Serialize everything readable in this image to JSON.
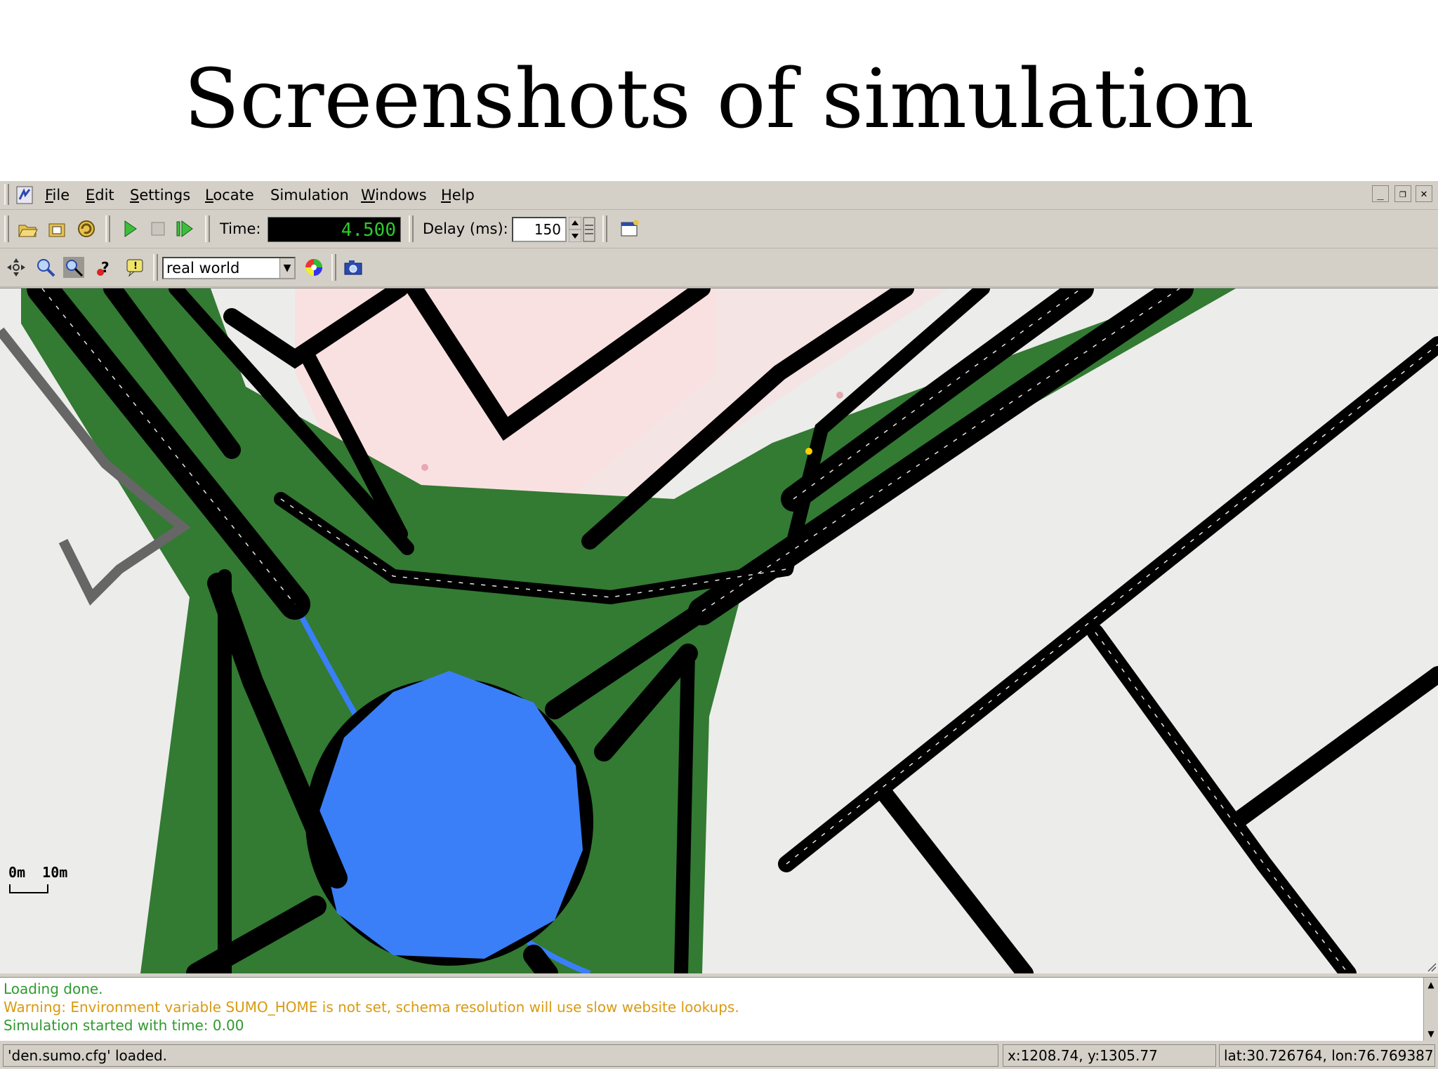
{
  "slide": {
    "title": "Screenshots of simulation"
  },
  "menubar": {
    "items": [
      "File",
      "Edit",
      "Settings",
      "Locate",
      "Simulation",
      "Windows",
      "Help"
    ],
    "window_controls": [
      "minimize",
      "restore",
      "close"
    ]
  },
  "toolbar1": {
    "time_label": "Time:",
    "time_value": "4.500",
    "delay_label": "Delay (ms):",
    "delay_value": "150"
  },
  "toolbar2": {
    "view_scheme": "real world"
  },
  "canvas": {
    "scale_label": "0m  10m",
    "colors": {
      "background": "#ececea",
      "road": "#000000",
      "green": "#337a33",
      "water": "#3a7ff8",
      "building": "#fae1e1"
    }
  },
  "messages": [
    {
      "text": "Loading done.",
      "color": "#2f9a2f"
    },
    {
      "text": "Warning: Environment variable SUMO_HOME is not set, schema resolution will use slow website lookups.",
      "color": "#d99a12"
    },
    {
      "text": "Simulation started with time: 0.00",
      "color": "#2f9a2f"
    }
  ],
  "statusbar": {
    "status": "'den.sumo.cfg' loaded.",
    "coords": "x:1208.74, y:1305.77",
    "latlon": "lat:30.726764, lon:76.769387"
  }
}
